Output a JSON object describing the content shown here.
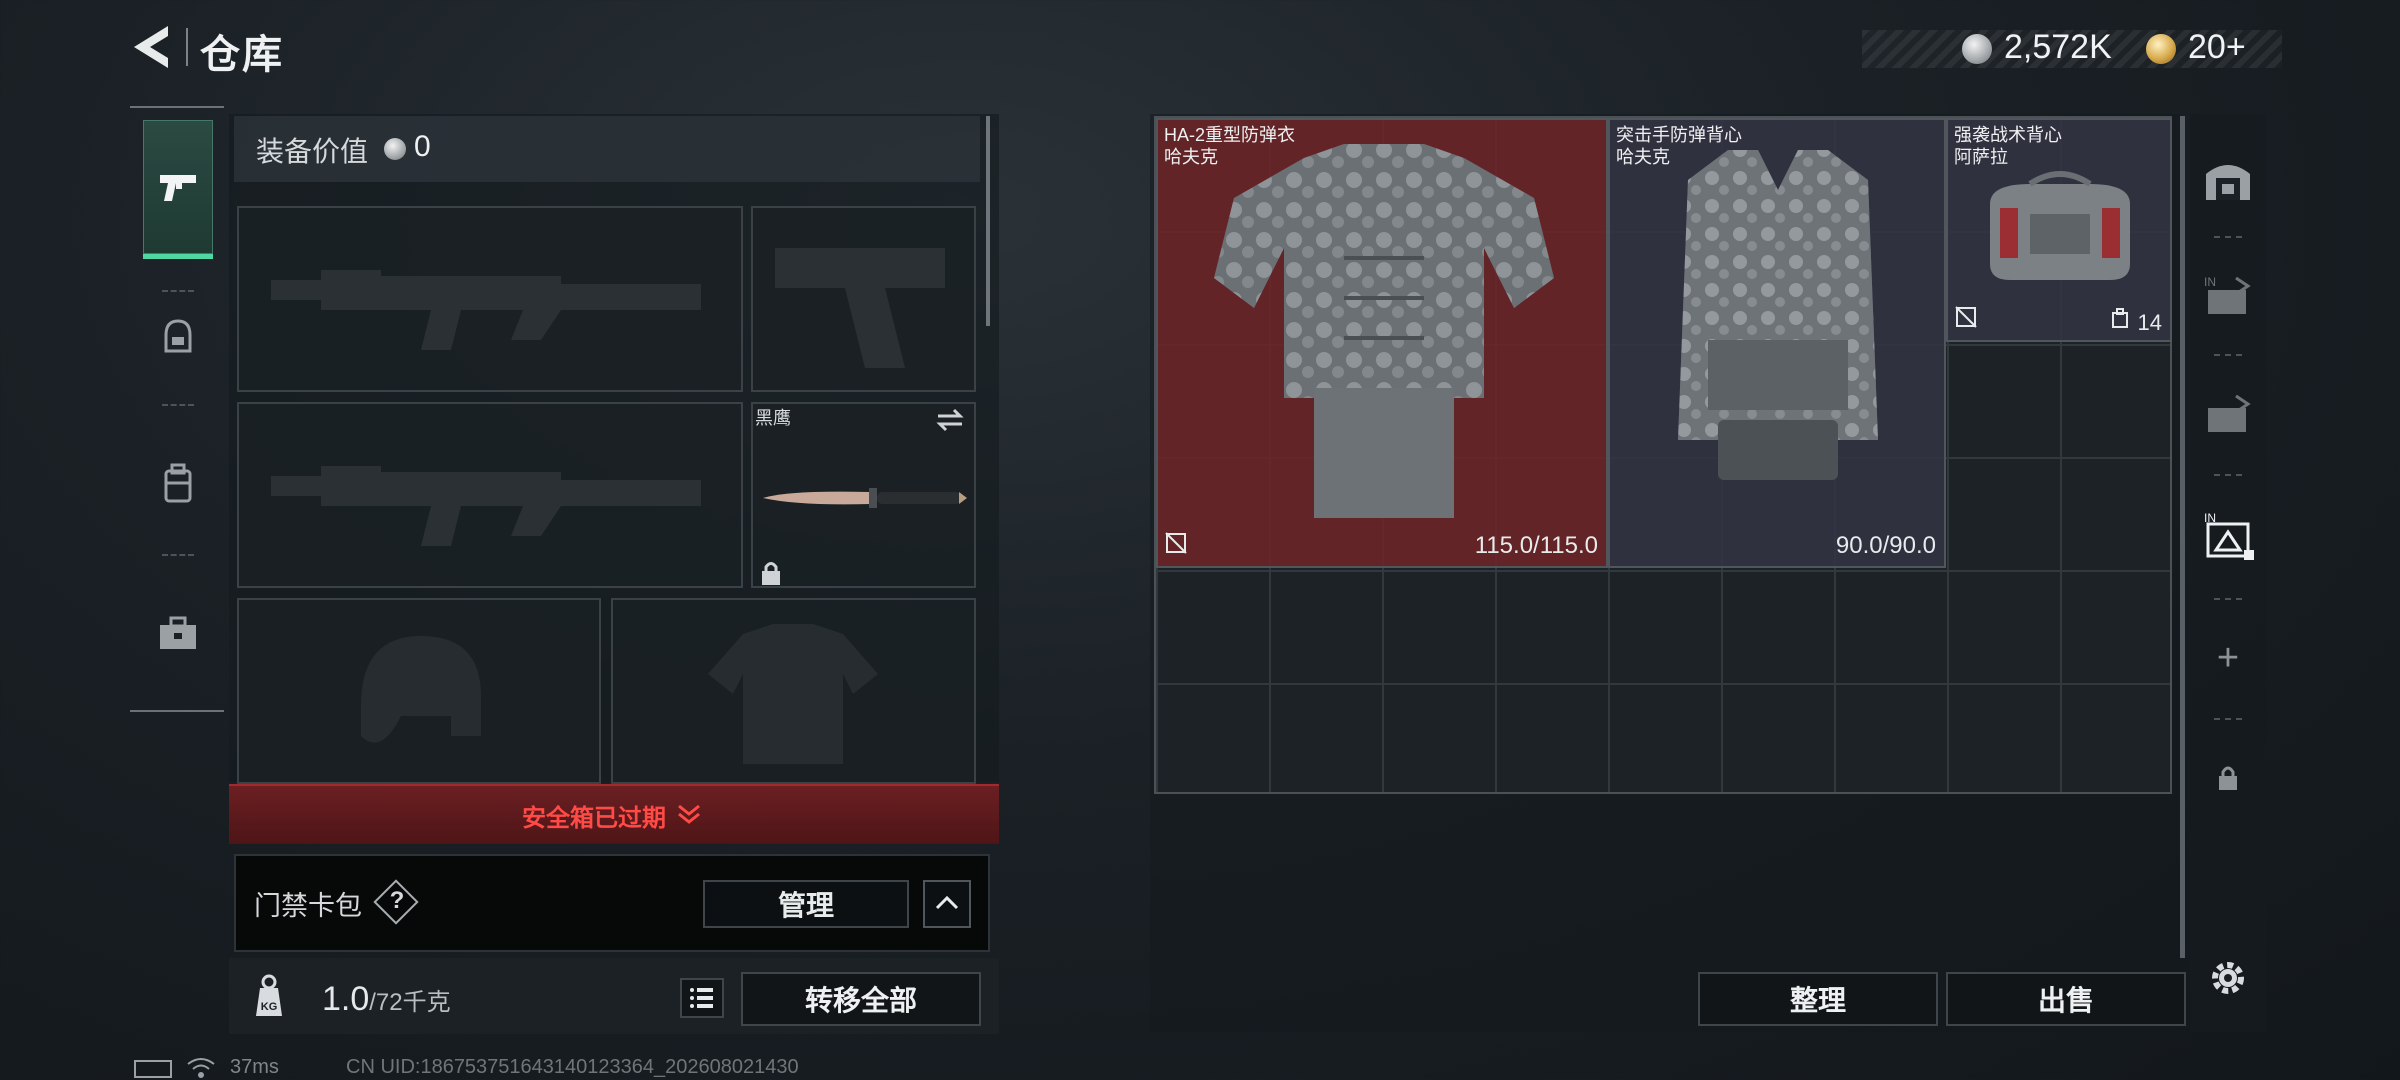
{
  "header": {
    "title": "仓库",
    "silver_amount": "2,572K",
    "gold_amount": "20+"
  },
  "tabs": [
    {
      "name": "weapons",
      "icon": "pistol-icon",
      "active": true
    },
    {
      "name": "gear",
      "icon": "helmet-icon",
      "active": false
    },
    {
      "name": "backpack",
      "icon": "backpack-icon",
      "active": false
    },
    {
      "name": "supplies",
      "icon": "briefcase-icon",
      "active": false
    }
  ],
  "loadout": {
    "equip_value_label": "装备价值",
    "equip_value": "0",
    "knife_name": "黑鹰",
    "safe_box_expired": "安全箱已过期",
    "keycard_label": "门禁卡包",
    "help_symbol": "?",
    "manage_label": "管理",
    "weight_current": "1.0",
    "weight_max": "/72千克",
    "transfer_all_label": "转移全部"
  },
  "stash": {
    "items": [
      {
        "name": "HA-2重型防弹衣",
        "maker": "哈夫克",
        "durability": "115.0/115.0",
        "color": "#6e2428"
      },
      {
        "name": "突击手防弹背心",
        "maker": "哈夫克",
        "durability": "90.0/90.0",
        "color": "#343444"
      },
      {
        "name": "强袭战术背心",
        "maker": "阿萨拉",
        "count": "14",
        "color": "#343444"
      }
    ],
    "sort_label": "整理",
    "sell_label": "出售"
  },
  "rail": {
    "icons": [
      "vault-icon",
      "transfer-in-icon",
      "transfer-out-icon",
      "container-active-icon",
      "add-icon",
      "lock-icon",
      "settings-icon"
    ],
    "add_symbol": "+"
  },
  "status": {
    "ping": "37ms",
    "uid": "CN UID:1867537516431401233​64_202608021430"
  },
  "colors": {
    "accent_green": "#50d6a3",
    "alert_red": "#ff4a45",
    "armor_red": "#6e2428"
  }
}
